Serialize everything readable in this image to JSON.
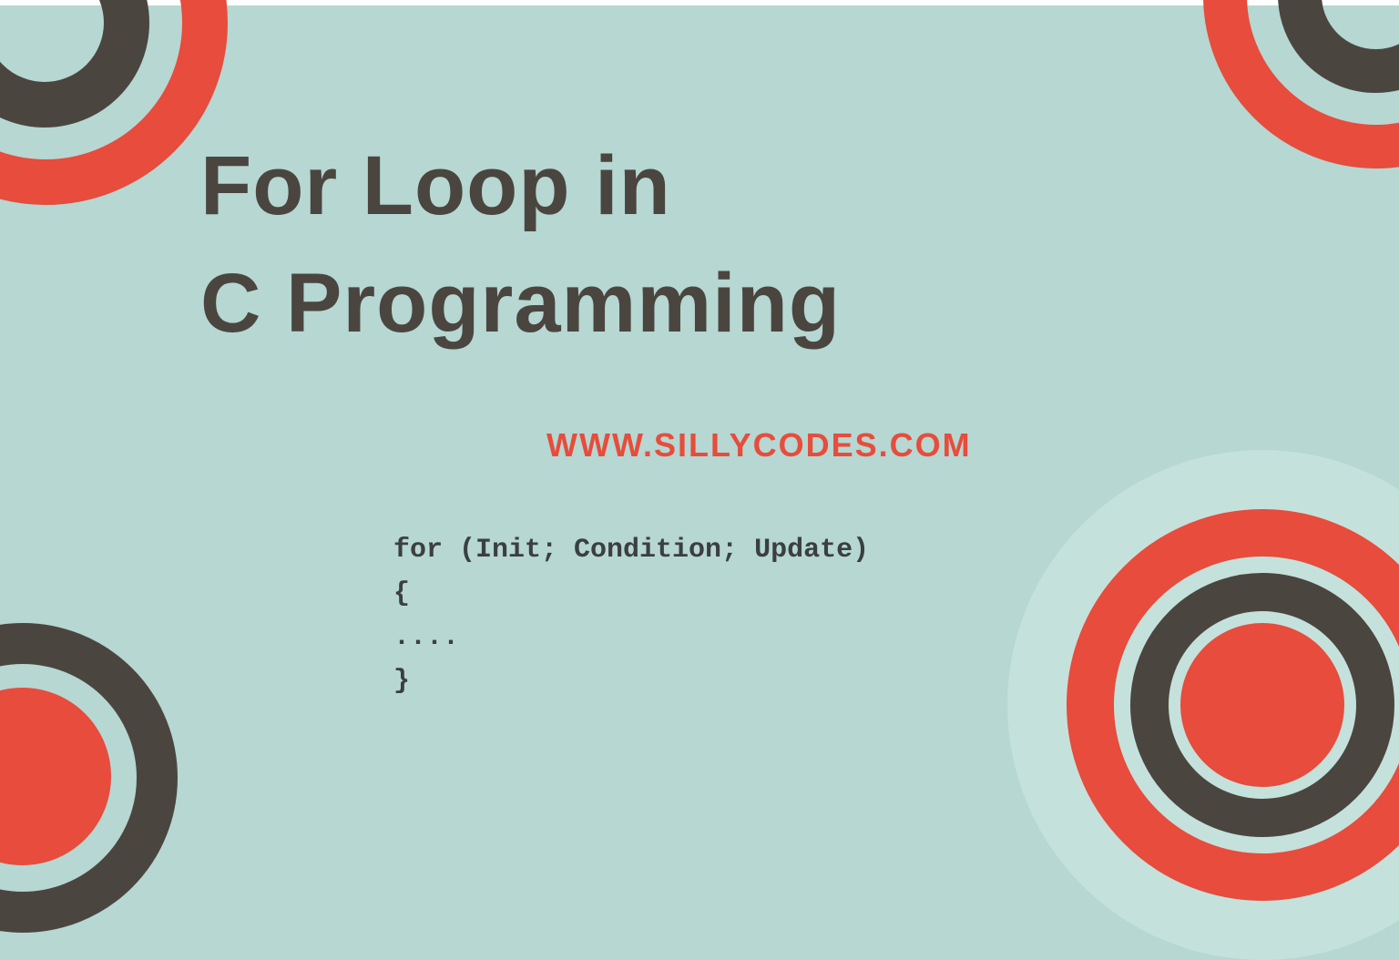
{
  "title_line1": "For Loop in",
  "title_line2": "C Programming",
  "website_url": "WWW.SILLYCODES.COM",
  "code": "for (Init; Condition; Update)\n{\n....\n}"
}
